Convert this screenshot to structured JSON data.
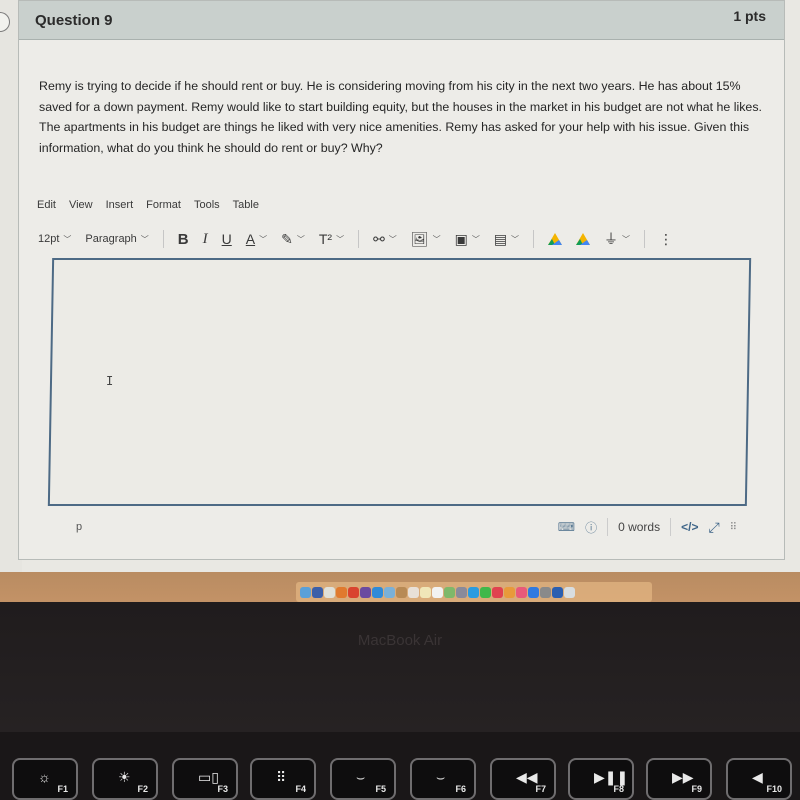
{
  "question": {
    "title": "Question 9",
    "points": "1 pts",
    "text": "Remy is trying to decide if he should rent or buy. He is considering moving from his city in the next two years.  He has about 15% saved for a down payment.  Remy would like to start building equity, but the houses in the market in his budget are not what he likes. The apartments in his budget are things he liked with very nice amenities.  Remy has asked for your help with his issue. Given this information, what do you think he should do rent or buy? Why?"
  },
  "editor": {
    "menu": [
      "Edit",
      "View",
      "Insert",
      "Format",
      "Tools",
      "Table"
    ],
    "toolbar": {
      "font_size": "12pt",
      "block_format": "Paragraph",
      "bold": "B",
      "italic": "I",
      "underline": "U",
      "text_color": "A",
      "highlight": "✎",
      "superscript": "T²"
    },
    "content": "",
    "status": {
      "path": "p",
      "word_count": "0 words",
      "code_view": "</>"
    }
  },
  "dock": {
    "apps": [
      "Finder",
      "Launchpad",
      "Photos-like",
      "Keychain",
      "Chrome",
      "Siri",
      "Safari",
      "Preview",
      "Notes-brown",
      "Calendar",
      "Notes",
      "Reminders",
      "Maps",
      "Mail-rocket",
      "Messages",
      "FaceTime",
      "News",
      "Photos",
      "Music",
      "App Store",
      "System Preferences",
      "Word",
      "Trash"
    ],
    "colors": [
      "#5aa0d8",
      "#3b5fa8",
      "#e0e0d8",
      "#e07a2e",
      "#d9442f",
      "#6b4aa0",
      "#2f8ad8",
      "#7ab0d8",
      "#b88a55",
      "#e8e0d8",
      "#f0e6b8",
      "#f2f2f2",
      "#7fb86a",
      "#8a8a9a",
      "#2b9be0",
      "#3fb84a",
      "#e0434f",
      "#e89a3a",
      "#e85a7a",
      "#2f7ae0",
      "#8a8a8a",
      "#2b5fb0",
      "#d8dde0"
    ]
  },
  "device": {
    "brand": "MacBook Air"
  },
  "keyboard": {
    "keys": [
      {
        "label": "F1",
        "icon": "☼"
      },
      {
        "label": "F2",
        "icon": "☀"
      },
      {
        "label": "F3",
        "icon": "▭▯"
      },
      {
        "label": "F4",
        "icon": "⠿"
      },
      {
        "label": "F5",
        "icon": "⌣"
      },
      {
        "label": "F6",
        "icon": "⌣"
      },
      {
        "label": "F7",
        "icon": "◀◀"
      },
      {
        "label": "F8",
        "icon": "▶❚❚"
      },
      {
        "label": "F9",
        "icon": "▶▶"
      },
      {
        "label": "F10",
        "icon": "◀"
      }
    ]
  }
}
